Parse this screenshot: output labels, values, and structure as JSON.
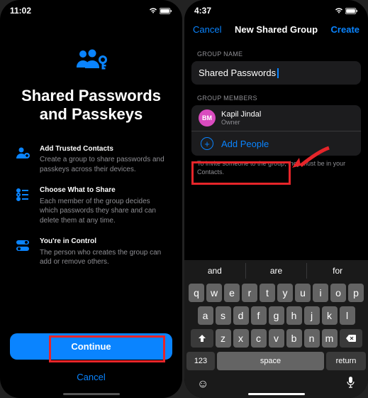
{
  "left": {
    "time": "11:02",
    "title": "Shared Passwords and Passkeys",
    "features": [
      {
        "title": "Add Trusted Contacts",
        "desc": "Create a group to share passwords and passkeys across their devices."
      },
      {
        "title": "Choose What to Share",
        "desc": "Each member of the group decides which passwords they share and can delete them at any time."
      },
      {
        "title": "You're in Control",
        "desc": "The person who creates the group can add or remove others."
      }
    ],
    "continue": "Continue",
    "cancel": "Cancel"
  },
  "right": {
    "time": "4:37",
    "nav": {
      "cancel": "Cancel",
      "title": "New Shared Group",
      "create": "Create"
    },
    "groupNameLabel": "GROUP NAME",
    "groupName": "Shared Passwords",
    "membersLabel": "GROUP MEMBERS",
    "member": {
      "initials": "BM",
      "name": "Kapil Jindal",
      "role": "Owner"
    },
    "addPeople": "Add People",
    "helper": "To invite someone to the group, they must be in your Contacts.",
    "suggestions": [
      "and",
      "are",
      "for"
    ],
    "keys1": [
      "q",
      "w",
      "e",
      "r",
      "t",
      "y",
      "u",
      "i",
      "o",
      "p"
    ],
    "keys2": [
      "a",
      "s",
      "d",
      "f",
      "g",
      "h",
      "j",
      "k",
      "l"
    ],
    "keys3": [
      "z",
      "x",
      "c",
      "v",
      "b",
      "n",
      "m"
    ],
    "numKey": "123",
    "space": "space",
    "return": "return"
  }
}
